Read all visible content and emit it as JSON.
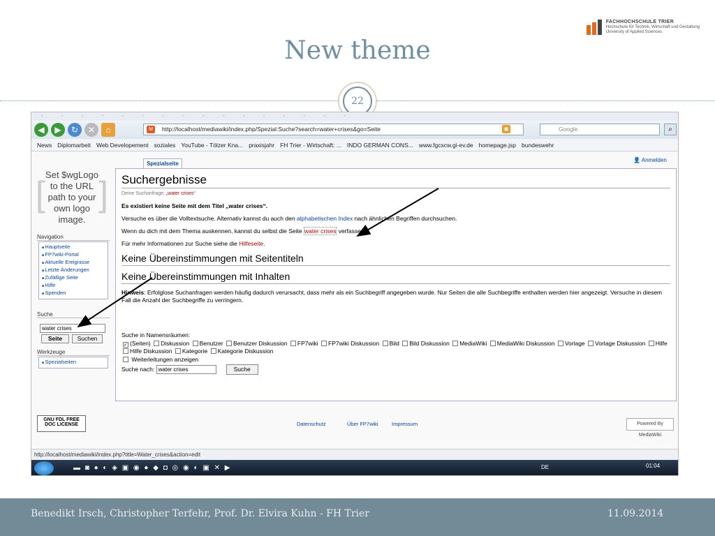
{
  "slide": {
    "title": "New theme",
    "page_number": "22",
    "footer_authors": "Benedikt Irsch, Christopher Terfehr, Prof. Dr. Elvira Kuhn - FH Trier",
    "footer_date": "11.09.2014",
    "logo_name": "FACHHOCHSCHULE TRIER",
    "logo_sub1": "Hochschule für Technik, Wirtschaft und Gestaltung",
    "logo_sub2": "University of Applied Sciences"
  },
  "browser": {
    "url": "http://localhost/mediawiki/index.php/Spezial:Suche?search=water+crises&go=Seite",
    "search_placeholder": "Google",
    "bookmarks": [
      "News",
      "Diplomarbeit",
      "Web Developement",
      "soziales",
      "YouTube - Tölzer Kna...",
      "praxisjahr",
      "FH Trier - Wirtschaft: ...",
      "INDO GERMAN CONS...",
      "www.fgcscw.gi-ev.de",
      "homepage.jsp",
      "bundeswehr"
    ],
    "status_url": "http://localhost/mediawiki/index.php?title=Water_crises&action=edit",
    "lang": "DE",
    "clock": "01:04"
  },
  "wiki": {
    "logo_text": "Set $wgLogo to the URL path to your own logo image.",
    "tab": "Spezialseite",
    "login": "Anmelden",
    "nav_heading": "Navigation",
    "nav": [
      "Hauptseite",
      "FP7wiki-Portal",
      "Aktuelle Ereignisse",
      "Letzte Änderungen",
      "Zufällige Seite",
      "Hilfe",
      "Spenden"
    ],
    "search_heading": "Suche",
    "search_value": "water crises",
    "btn_page": "Seite",
    "btn_search": "Suchen",
    "tools_heading": "Werkzeuge",
    "tools": [
      "Spezialseiten"
    ],
    "h1": "Suchergebnisse",
    "query_prefix": "Deine Suchanfrage: ",
    "query": "„water crises“",
    "no_page": "Es existiert keine Seite mit dem Titel „water crises“.",
    "p1a": "Versuche es über die Volltextsuche. Alternativ kannst du auch den ",
    "p1link": "alphabetischen Index",
    "p1b": " nach ähnlichen Begriffen durchsuchen.",
    "p2a": "Wenn du dich mit dem Thema auskennen, kannst du selbst die Seite ",
    "p2link": "water crises",
    "p2b": " verfassen.",
    "p3a": "Für mehr Informationen zur Suche siehe die ",
    "p3link": "Hilfeseite",
    "h2a": "Keine Übereinstimmungen mit Seitentiteln",
    "h2b": "Keine Übereinstimmungen mit Inhalten",
    "hint_bold": "Hinweis",
    "hint": ": Erfolglose Suchanfragen werden häufig dadurch verursacht, dass mehr als ein Suchbegriff angegeben wurde. Nur Seiten die alle Suchbegriffe enthalten werden hier angezeigt. Versuche in diesem Fall die Anzahl der Suchbegriffe zu verringern.",
    "ns_label": "Suche in Namensräumen:",
    "namespaces": [
      "(Seiten)",
      "Diskussion",
      "Benutzer",
      "Benutzer Diskussion",
      "FP7wiki",
      "FP7wiki Diskussion",
      "Bild",
      "Bild Diskussion",
      "MediaWiki",
      "MediaWiki Diskussion",
      "Vorlage",
      "Vorlage Diskussion",
      "Hilfe",
      "Hilfe Diskussion",
      "Kategorie",
      "Kategorie Diskussion"
    ],
    "redirects": "Weiterleitungen anzeigen",
    "search_for": "Suche nach:",
    "search_for_value": "water crises",
    "search_btn": "Suche",
    "footer_links": [
      "Datenschutz",
      "Über FP7wiki",
      "Impressum"
    ],
    "gnu": "GNU FDL FREE DOC LICENSE",
    "mw_badge": "Powered By MediaWiki"
  }
}
